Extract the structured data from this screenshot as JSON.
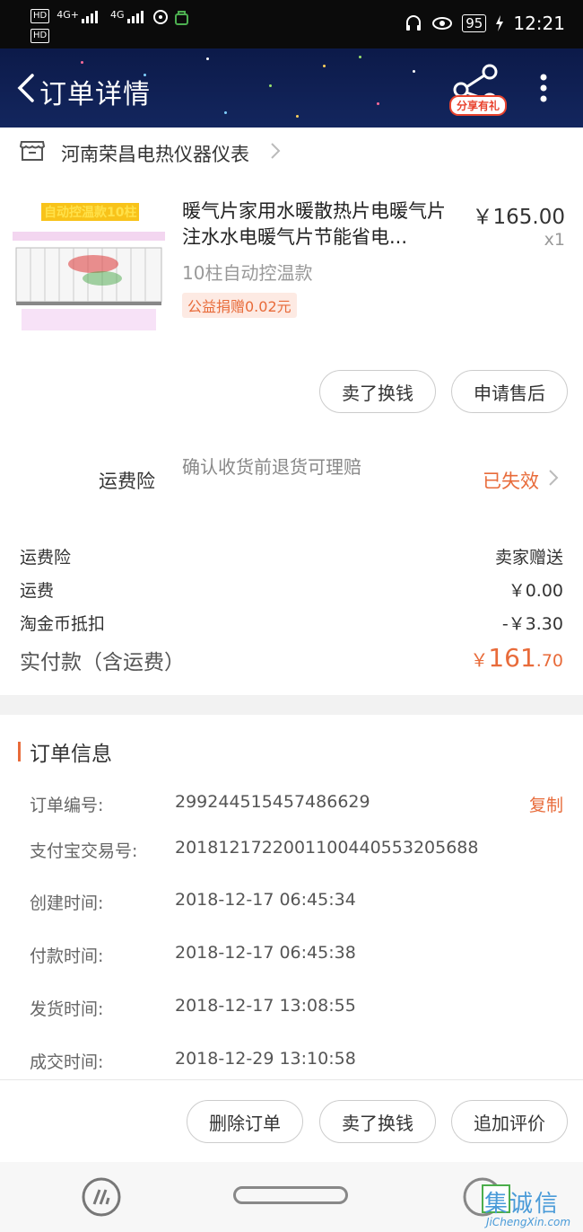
{
  "statusbar": {
    "sim1": "HD",
    "sim2": "HD",
    "network1": "4G+",
    "network2": "4G",
    "battery": "95",
    "time": "12:21"
  },
  "header": {
    "title": "订单详情",
    "share_badge": "分享有礼",
    "icons": [
      "back-icon",
      "share-icon",
      "more-icon"
    ],
    "colors": {
      "bg": "#0c1a49",
      "accent": "#e86b3a"
    }
  },
  "shop": {
    "name": "河南荣昌电热仪器仪表"
  },
  "product": {
    "image_text": "自动控温款10柱",
    "title": "暖气片家用水暖散热片电暖气片注水水电暖气片节能省电...",
    "sku": "10柱自动控温款",
    "charity": "公益捐赠0.02元",
    "price": "￥165.00",
    "quantity": "x1"
  },
  "product_actions": {
    "sell": "卖了换钱",
    "after_sale": "申请售后"
  },
  "insurance": {
    "label": "运费险",
    "desc": "确认收货前退货可理赔",
    "status": "已失效"
  },
  "fees": {
    "rows": [
      {
        "label": "运费险",
        "value": "卖家赠送"
      },
      {
        "label": "运费",
        "value": "￥0.00"
      },
      {
        "label": "淘金币抵扣",
        "value": "-￥3.30"
      }
    ],
    "paid_label": "实付款（含运费）",
    "paid_symbol": "￥",
    "paid_int": "161",
    "paid_dec": ".70"
  },
  "order_info": {
    "title": "订单信息",
    "copy": "复制",
    "rows": [
      {
        "label": "订单编号:",
        "value": "299244515457486629"
      },
      {
        "label": "支付宝交易号:",
        "value": "2018121722001100440553205688"
      },
      {
        "label": "创建时间:",
        "value": "2018-12-17 06:45:34"
      },
      {
        "label": "付款时间:",
        "value": "2018-12-17 06:45:38"
      },
      {
        "label": "发货时间:",
        "value": "2018-12-17 13:08:55"
      },
      {
        "label": "成交时间:",
        "value": "2018-12-29 13:10:58"
      }
    ]
  },
  "bottom_actions": {
    "delete": "删除订单",
    "sell": "卖了换钱",
    "review": "追加评价"
  },
  "watermark": {
    "char": "集诚信",
    "url": "JiChengXin.com"
  }
}
